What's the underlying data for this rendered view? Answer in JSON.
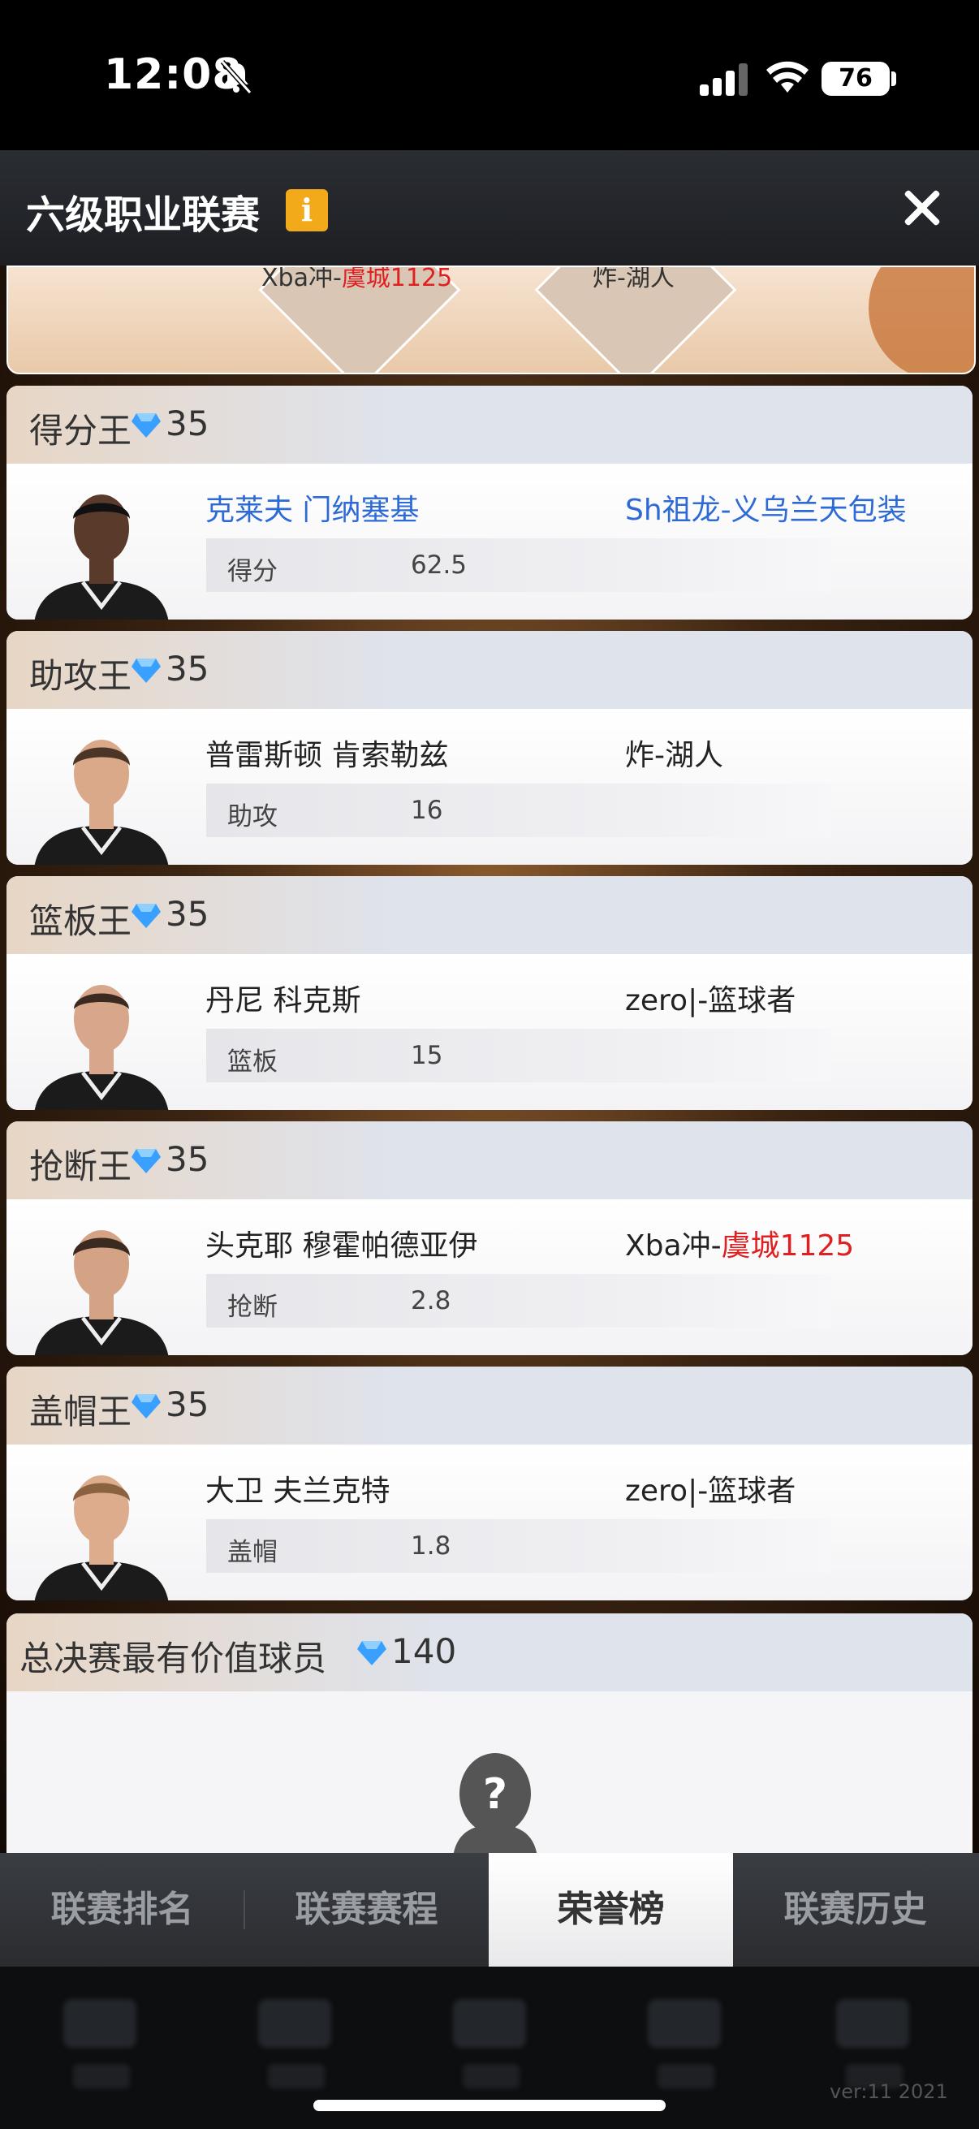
{
  "status": {
    "time": "12:08",
    "battery": "76"
  },
  "header": {
    "title": "六级职业联赛",
    "info_label": "i"
  },
  "top_card": {
    "team_left_prefix": "Xba冲-",
    "team_left_red": "虞城1125",
    "team_right": "炸-湖人"
  },
  "awards": [
    {
      "title": "得分王",
      "gem": "35",
      "player": "克莱夫 门纳塞基",
      "team": "Sh祖龙-义乌兰天包装",
      "stat_label": "得分",
      "stat_value": "62.5",
      "skin": "#5a3a2a"
    },
    {
      "title": "助攻王",
      "gem": "35",
      "player": "普雷斯顿 肯索勒兹",
      "team": "炸-湖人",
      "stat_label": "助攻",
      "stat_value": "16",
      "skin": "#d9a98a"
    },
    {
      "title": "篮板王",
      "gem": "35",
      "player": "丹尼 科克斯",
      "team": "zero|-篮球者",
      "stat_label": "篮板",
      "stat_value": "15",
      "skin": "#d8a68a"
    },
    {
      "title": "抢断王",
      "gem": "35",
      "player": "头克耶 穆霍帕德亚伊",
      "team_prefix": "Xba冲-",
      "team_red": "虞城1125",
      "stat_label": "抢断",
      "stat_value": "2.8",
      "skin": "#d4a385"
    },
    {
      "title": "盖帽王",
      "gem": "35",
      "player": "大卫 夫兰克特",
      "team": "zero|-篮球者",
      "stat_label": "盖帽",
      "stat_value": "1.8",
      "skin": "#dcac8d"
    }
  ],
  "mvp": {
    "title": "总决赛最有价值球员",
    "gem": "140"
  },
  "tabs": [
    "联赛排名",
    "联赛赛程",
    "荣誉榜",
    "联赛历史"
  ],
  "active_tab": "荣誉榜",
  "version": "ver:11  2021",
  "colors": {
    "accent_blue": "#2d6ad6",
    "accent_red": "#e02020",
    "badge_orange": "#f2a91a",
    "gem_blue": "#3aa0ff"
  }
}
